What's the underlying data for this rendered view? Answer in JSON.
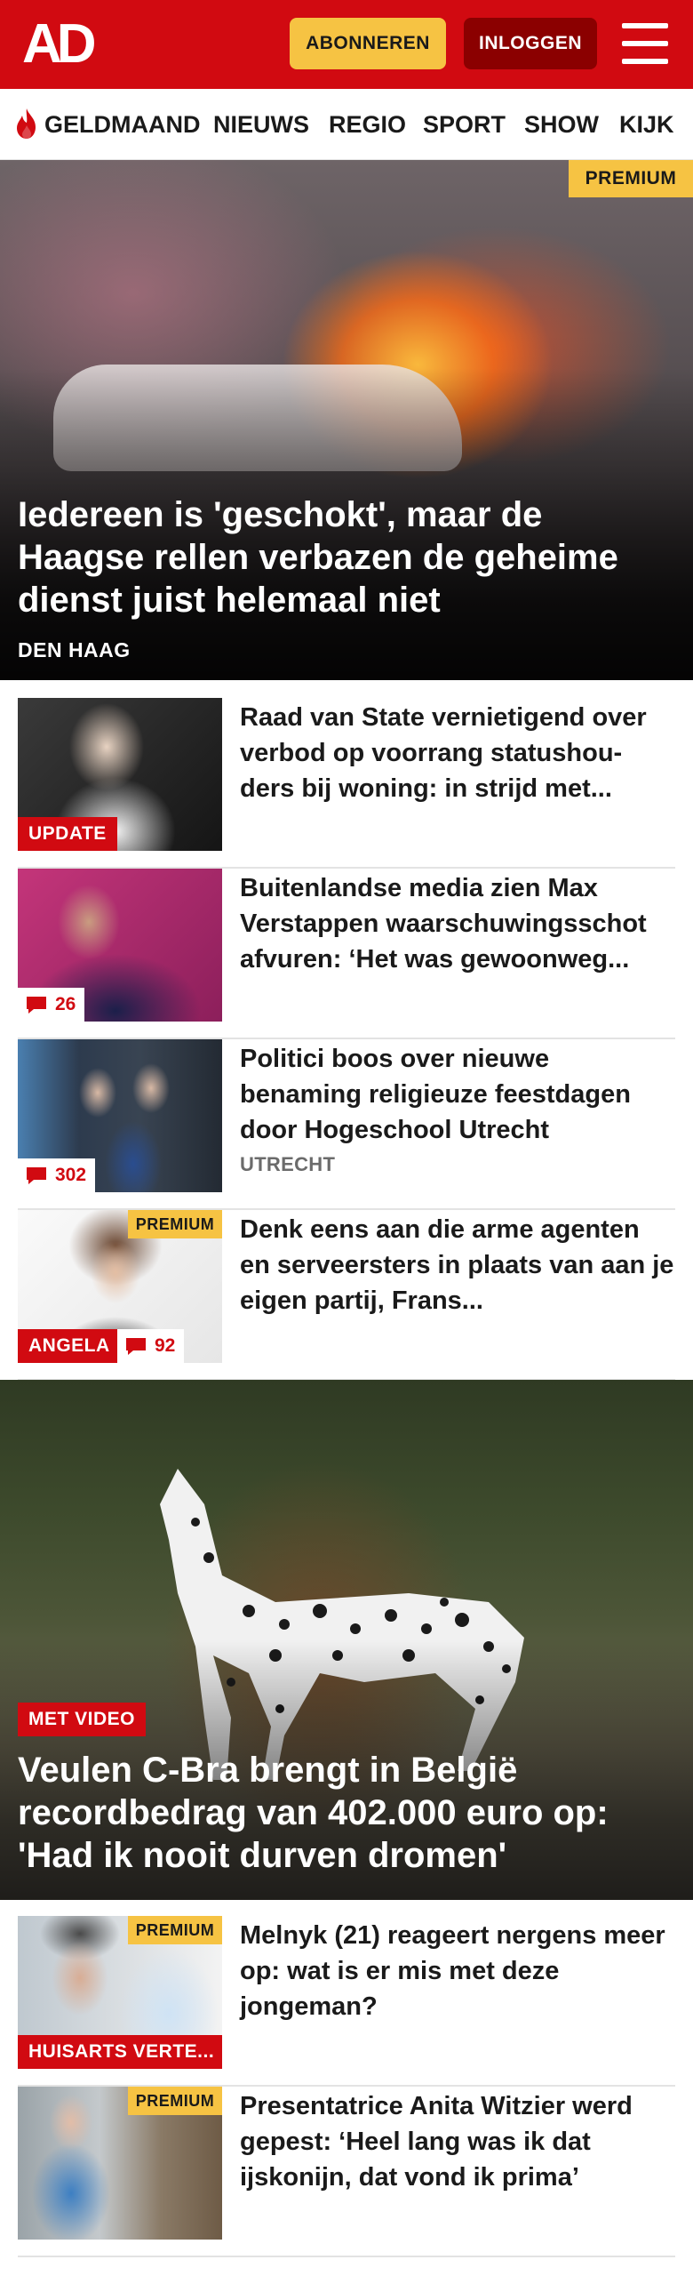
{
  "header": {
    "logo": "AD",
    "subscribe_label": "ABONNEREN",
    "login_label": "INLOGGEN"
  },
  "nav": {
    "items": [
      "GELDMAAND",
      "NIEUWS",
      "REGIO",
      "SPORT",
      "SHOW",
      "KIJK"
    ]
  },
  "hero": {
    "badge": "PREMIUM",
    "title": "Iedereen is 'geschokt', maar de Haagse rellen verbazen de geheime dienst juist helemaal niet",
    "location": "DEN HAAG"
  },
  "articles": [
    {
      "title": "Raad van State vernietigend over verbod op voorrang statushou-ders bij woning: in strijd met...",
      "label": "UPDATE"
    },
    {
      "title": "Buitenlandse media zien Max Verstappen waarschuwingsschot afvuren: ‘Het was gewoonweg...",
      "comments": "26"
    },
    {
      "title": "Politici boos over nieuwe benaming religieuze feestdagen door Hogeschool Utrecht",
      "location": "UTRECHT",
      "comments": "302"
    },
    {
      "title": "Denk eens aan die arme agenten en serveersters in plaats van aan je eigen partij, Frans...",
      "badge": "PREMIUM",
      "label": "ANGELA",
      "comments": "92"
    }
  ],
  "feature": {
    "label": "MET VIDEO",
    "title": "Veulen C-Bra brengt in België recordbedrag van 402.000 euro op: 'Had ik nooit durven dromen'"
  },
  "articles2": [
    {
      "title": "Melnyk (21) reageert nergens meer op: wat is er mis met deze jongeman?",
      "badge": "PREMIUM",
      "label": "HUISARTS VERTE..."
    },
    {
      "title": "Presentatrice Anita Witzier werd gepest: ‘Heel lang was ik dat ijskonijn, dat vond ik prima’",
      "badge": "PREMIUM"
    }
  ],
  "icons": {
    "flame": "flame-icon",
    "menu": "hamburger-menu-icon",
    "comment": "comment-icon"
  },
  "colors": {
    "brand_red": "#d10a11",
    "premium_yellow": "#f6c343",
    "login_dark_red": "#8b0000"
  }
}
